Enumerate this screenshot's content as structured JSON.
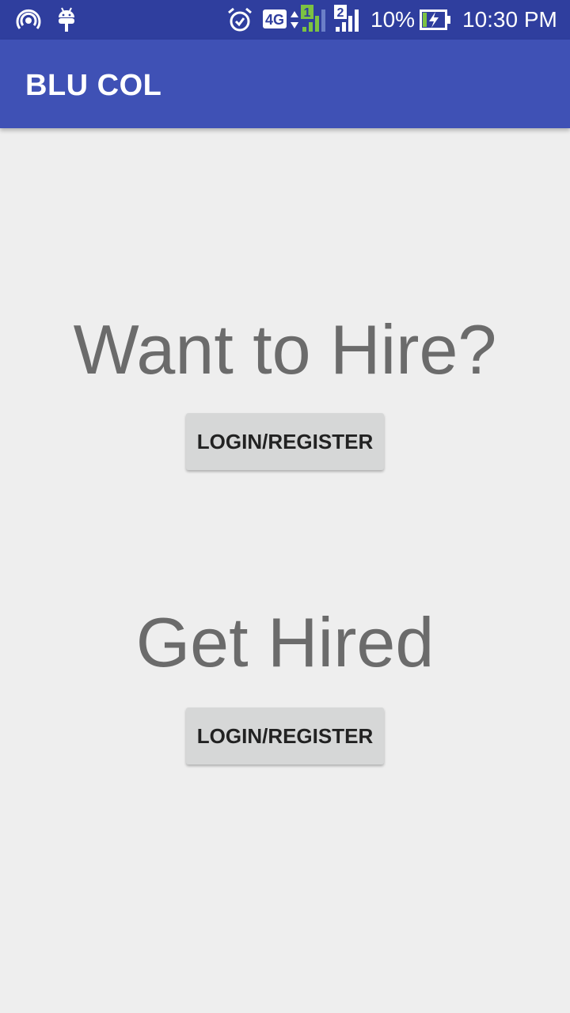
{
  "status_bar": {
    "icons": [
      "hotspot-icon",
      "android-debug-icon",
      "alarm-icon",
      "network-4g-icon",
      "signal-sim1-icon",
      "signal-sim2-icon",
      "battery-charging-icon"
    ],
    "network_type": "4G",
    "sim1_label": "1",
    "sim2_label": "2",
    "battery_percent": "10%",
    "time": "10:30 PM",
    "colors": {
      "background": "#2f3e9e",
      "sim1_signal": "#7cc242"
    }
  },
  "app_bar": {
    "title": "BLU COL",
    "color": "#3f51b5"
  },
  "main": {
    "hire_section": {
      "heading": "Want to Hire?",
      "button_label": "LOGIN/REGISTER"
    },
    "get_hired_section": {
      "heading": "Get Hired",
      "button_label": "LOGIN/REGISTER"
    }
  }
}
